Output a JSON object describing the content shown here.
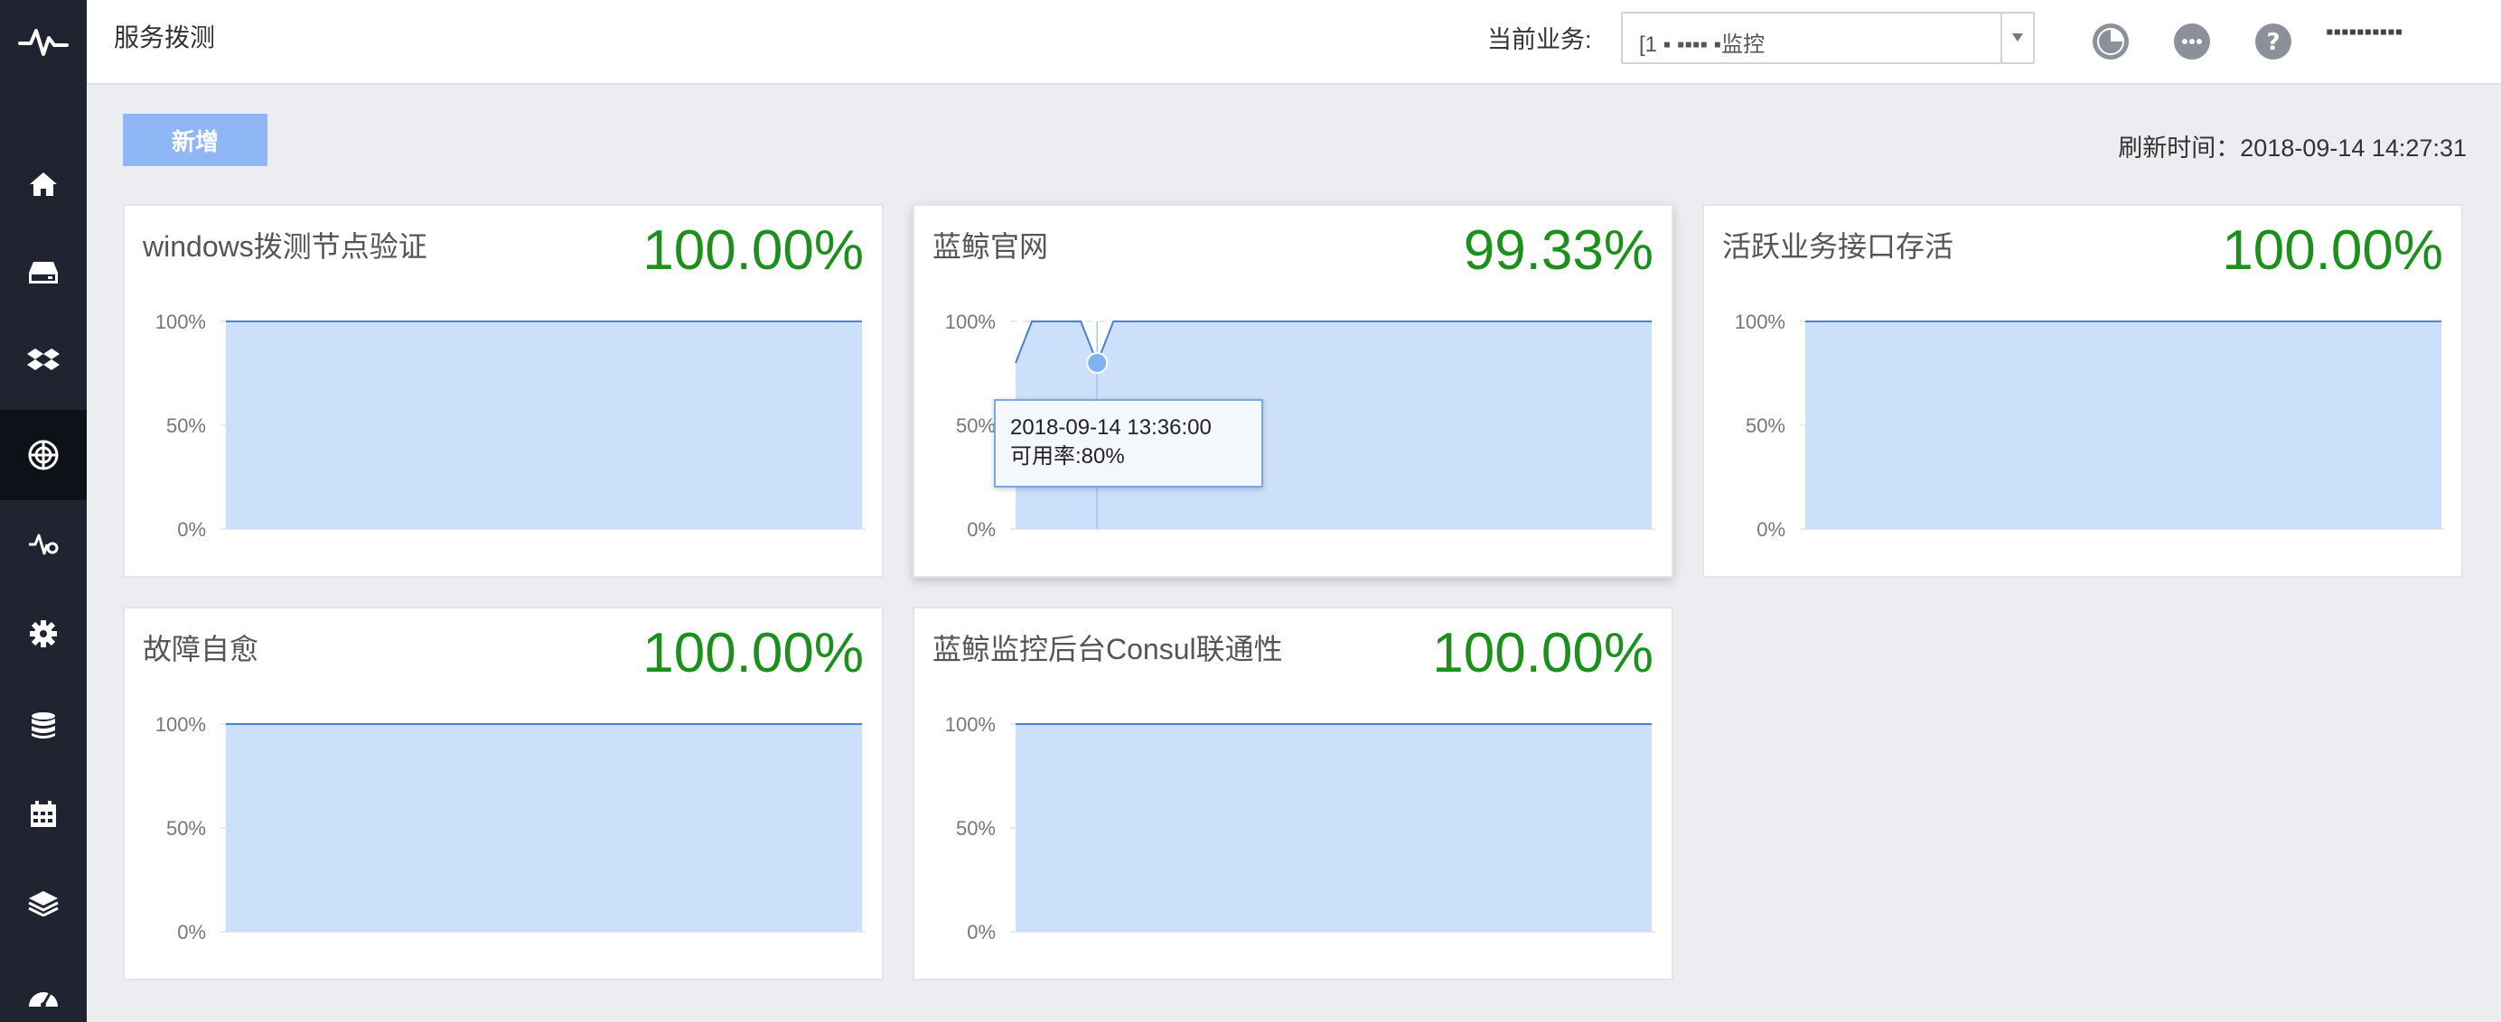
{
  "header": {
    "page_title": "服务拨测",
    "business_label": "当前业务:",
    "business_value": "[1 ▪ ▪▪▪▪ ▪监控",
    "username": "▪▪▪▪▪▪▪▪▪▪"
  },
  "toolbar": {
    "add_label": "新增",
    "refresh_text": "刷新时间：2018-09-14 14:27:31"
  },
  "sidebar": {
    "items": [
      {
        "icon": "home-icon"
      },
      {
        "icon": "storage-icon"
      },
      {
        "icon": "dropbox-icon"
      },
      {
        "icon": "dial-test-icon",
        "active": true
      },
      {
        "icon": "pulse-settings-icon"
      },
      {
        "icon": "gear-icon"
      },
      {
        "icon": "database-icon"
      },
      {
        "icon": "calendar-icon"
      },
      {
        "icon": "layers-icon"
      },
      {
        "icon": "dashboard-icon"
      }
    ]
  },
  "cards": [
    {
      "title": "windows拨测节点验证",
      "rate": "100.00%",
      "y_ticks": [
        "100%",
        "50%",
        "0%"
      ]
    },
    {
      "title": "蓝鲸官网",
      "rate": "99.33%",
      "y_ticks": [
        "100%",
        "50%",
        "0%"
      ]
    },
    {
      "title": "活跃业务接口存活",
      "rate": "100.00%",
      "y_ticks": [
        "100%",
        "50%",
        "0%"
      ]
    },
    {
      "title": "故障自愈",
      "rate": "100.00%",
      "y_ticks": [
        "100%",
        "50%",
        "0%"
      ]
    },
    {
      "title": "蓝鲸监控后台Consul联通性",
      "rate": "100.00%",
      "y_ticks": [
        "100%",
        "50%",
        "0%"
      ]
    }
  ],
  "tooltip": {
    "time": "2018-09-14 13:36:00",
    "value": "可用率:80%"
  },
  "colors": {
    "rate_green": "#1c8f1c",
    "area_fill": "#cce0fb",
    "line": "#4a7fd4",
    "accent_button": "#8fb6f5"
  },
  "chart_data": [
    {
      "type": "area",
      "title": "windows拨测节点验证",
      "ylim": [
        0,
        100
      ],
      "y_ticks": [
        "100%",
        "50%",
        "0%"
      ],
      "series": [
        {
          "values": [
            100,
            100,
            100,
            100,
            100,
            100,
            100,
            100,
            100,
            100
          ]
        }
      ]
    },
    {
      "type": "area",
      "title": "蓝鲸官网",
      "ylim": [
        0,
        100
      ],
      "y_ticks": [
        "100%",
        "50%",
        "0%"
      ],
      "series": [
        {
          "values": [
            80,
            100,
            100,
            100,
            100,
            80,
            100,
            100,
            100,
            100,
            100,
            100,
            100,
            100,
            100,
            100,
            100,
            100,
            100,
            100,
            100,
            100,
            100,
            100,
            100,
            100,
            100,
            100,
            100,
            100,
            100,
            100,
            100,
            100,
            100,
            100,
            100,
            100,
            100,
            100
          ]
        }
      ],
      "highlight": {
        "index": 5,
        "x": "2018-09-14 13:36:00",
        "y": 80
      }
    },
    {
      "type": "area",
      "title": "活跃业务接口存活",
      "ylim": [
        0,
        100
      ],
      "y_ticks": [
        "100%",
        "50%",
        "0%"
      ],
      "series": [
        {
          "values": [
            100,
            100,
            100,
            100,
            100,
            100,
            100,
            100,
            100,
            100
          ]
        }
      ]
    },
    {
      "type": "area",
      "title": "故障自愈",
      "ylim": [
        0,
        100
      ],
      "y_ticks": [
        "100%",
        "50%",
        "0%"
      ],
      "series": [
        {
          "values": [
            100,
            100,
            100,
            100,
            100,
            100,
            100,
            100,
            100,
            100
          ]
        }
      ]
    },
    {
      "type": "area",
      "title": "蓝鲸监控后台Consul联通性",
      "ylim": [
        0,
        100
      ],
      "y_ticks": [
        "100%",
        "50%",
        "0%"
      ],
      "series": [
        {
          "values": [
            100,
            100,
            100,
            100,
            100,
            100,
            100,
            100,
            100,
            100
          ]
        }
      ]
    }
  ]
}
